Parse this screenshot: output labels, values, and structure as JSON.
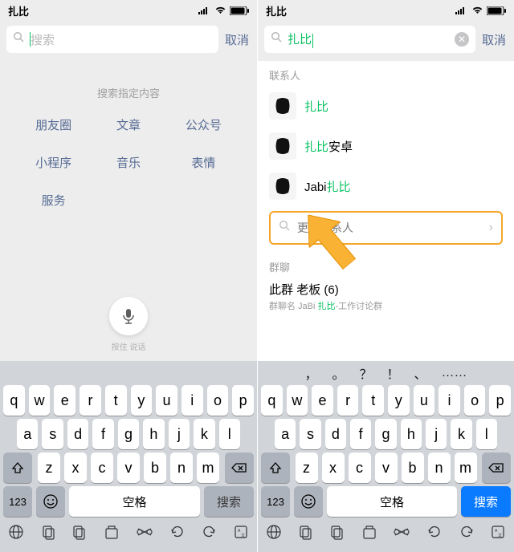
{
  "left": {
    "status_title": "扎比",
    "search_placeholder": "搜索",
    "cancel": "取消",
    "suggest_header": "搜索指定内容",
    "categories": [
      "朋友圈",
      "文章",
      "公众号",
      "小程序",
      "音乐",
      "表情",
      "服务"
    ],
    "mic_label": "按住 说话",
    "keyboard": {
      "row1": [
        "q",
        "w",
        "e",
        "r",
        "t",
        "y",
        "u",
        "i",
        "o",
        "p"
      ],
      "row2": [
        "a",
        "s",
        "d",
        "f",
        "g",
        "h",
        "j",
        "k",
        "l"
      ],
      "row3": [
        "z",
        "x",
        "c",
        "v",
        "b",
        "n",
        "m"
      ],
      "num_key": "123",
      "space": "空格",
      "action": "搜索"
    }
  },
  "right": {
    "status_title": "扎比",
    "search_value": "扎比",
    "cancel": "取消",
    "section_contacts": "联系人",
    "contacts": [
      {
        "prefix": "",
        "hl": "扎比",
        "suffix": ""
      },
      {
        "prefix": "",
        "hl": "扎比",
        "suffix": "安卓"
      },
      {
        "prefix": "Jabi",
        "hl": "扎比",
        "suffix": ""
      }
    ],
    "more_contacts": "更多联系人",
    "section_groups": "群聊",
    "group": {
      "title_prefix": "此群",
      "title_gap": "   ",
      "title_suffix": "老板 (6)",
      "sub_prefix": "群聊名  JaBi ",
      "sub_hl": "扎比",
      "sub_suffix": "-工作讨论群"
    },
    "predict": [
      "，",
      "。",
      "？",
      "！",
      "、",
      "……"
    ],
    "keyboard": {
      "row1": [
        "q",
        "w",
        "e",
        "r",
        "t",
        "y",
        "u",
        "i",
        "o",
        "p"
      ],
      "row2": [
        "a",
        "s",
        "d",
        "f",
        "g",
        "h",
        "j",
        "k",
        "l"
      ],
      "row3": [
        "z",
        "x",
        "c",
        "v",
        "b",
        "n",
        "m"
      ],
      "num_key": "123",
      "space": "空格",
      "action": "搜索"
    }
  }
}
